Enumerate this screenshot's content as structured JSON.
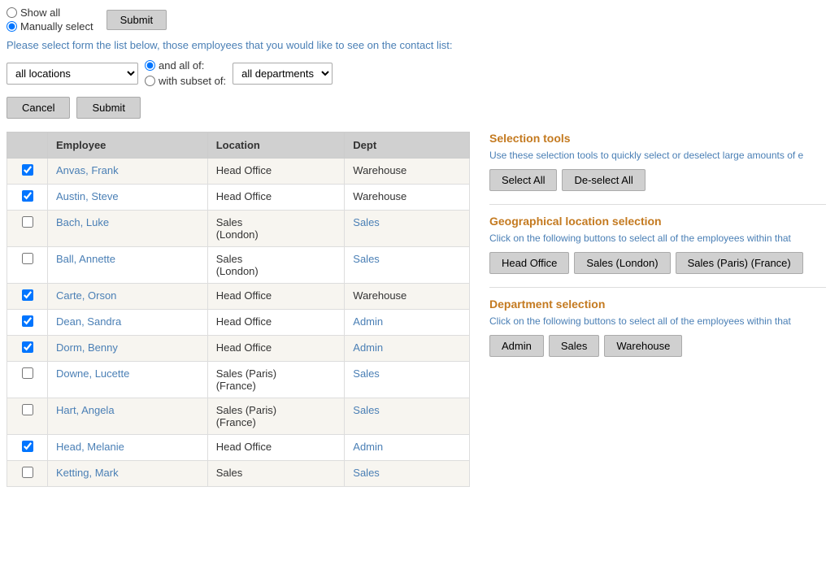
{
  "top": {
    "show_all_label": "Show all",
    "manually_select_label": "Manually select",
    "submit_label": "Submit"
  },
  "description": {
    "text_before": "Please select form the list below, those employees ",
    "text_link": "that you would like to see on the contact list",
    "text_after": ":"
  },
  "filters": {
    "location_options": [
      "all locations",
      "Head Office",
      "Sales (London)",
      "Sales (Paris) (France)"
    ],
    "location_selected": "all locations",
    "and_all_of_label": "and all of:",
    "with_subset_of_label": "with subset of:",
    "dept_options": [
      "all departments",
      "Admin",
      "Sales",
      "Warehouse"
    ],
    "dept_selected": "all departments"
  },
  "action_buttons": {
    "cancel_label": "Cancel",
    "submit_label": "Submit"
  },
  "table": {
    "headers": [
      "",
      "Employee",
      "Location",
      "Dept"
    ],
    "rows": [
      {
        "checked": true,
        "name": "Anvas, Frank",
        "location": "Head Office",
        "dept": "Warehouse"
      },
      {
        "checked": true,
        "name": "Austin, Steve",
        "location": "Head Office",
        "dept": "Warehouse"
      },
      {
        "checked": false,
        "name": "Bach, Luke",
        "location": "Sales\n(London)",
        "dept": "Sales"
      },
      {
        "checked": false,
        "name": "Ball, Annette",
        "location": "Sales\n(London)",
        "dept": "Sales"
      },
      {
        "checked": true,
        "name": "Carte, Orson",
        "location": "Head Office",
        "dept": "Warehouse"
      },
      {
        "checked": true,
        "name": "Dean, Sandra",
        "location": "Head Office",
        "dept": "Admin"
      },
      {
        "checked": true,
        "name": "Dorm, Benny",
        "location": "Head Office",
        "dept": "Admin"
      },
      {
        "checked": false,
        "name": "Downe, Lucette",
        "location": "Sales (Paris)\n(France)",
        "dept": "Sales"
      },
      {
        "checked": false,
        "name": "Hart, Angela",
        "location": "Sales (Paris)\n(France)",
        "dept": "Sales"
      },
      {
        "checked": true,
        "name": "Head, Melanie",
        "location": "Head Office",
        "dept": "Admin"
      },
      {
        "checked": false,
        "name": "Ketting, Mark",
        "location": "Sales",
        "dept": "Sales"
      }
    ]
  },
  "right_panel": {
    "selection_tools": {
      "title": "Selection tools",
      "description": "Use these selection tools to quickly select or deselect large amounts of e",
      "select_all_label": "Select All",
      "deselect_all_label": "De-select All"
    },
    "geo_selection": {
      "title": "Geographical location selection",
      "description": "Click on the following buttons to select all of the employees within that",
      "buttons": [
        "Head Office",
        "Sales (London)",
        "Sales (Paris) (France)"
      ]
    },
    "dept_selection": {
      "title": "Department selection",
      "description": "Click on the following buttons to select all of the employees within that",
      "buttons": [
        "Admin",
        "Sales",
        "Warehouse"
      ]
    }
  }
}
